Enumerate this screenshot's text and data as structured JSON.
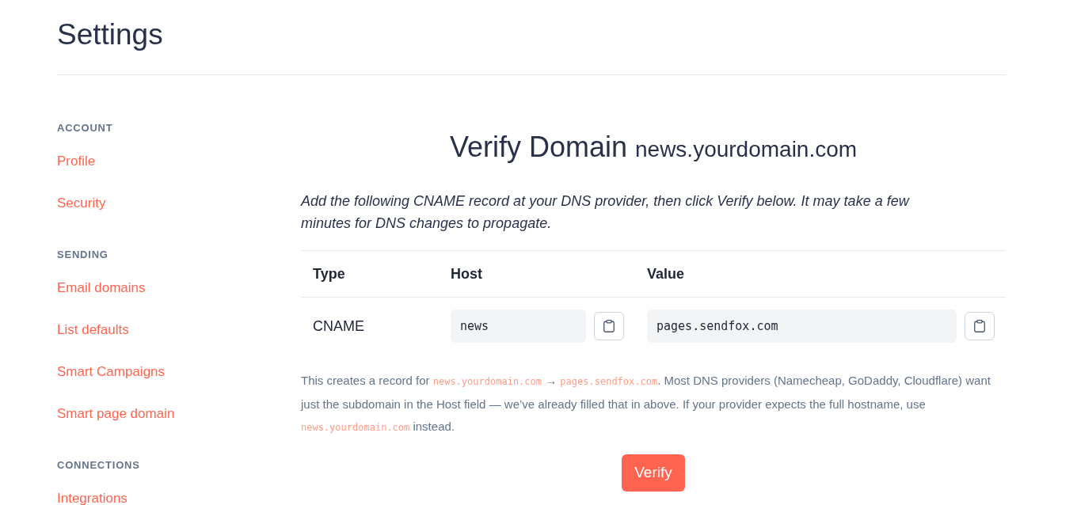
{
  "page": {
    "title": "Settings"
  },
  "sidebar": {
    "sections": [
      {
        "heading": "ACCOUNT",
        "items": [
          "Profile",
          "Security"
        ]
      },
      {
        "heading": "SENDING",
        "items": [
          "Email domains",
          "List defaults",
          "Smart Campaigns",
          "Smart page domain"
        ]
      },
      {
        "heading": "CONNECTIONS",
        "items": [
          "Integrations"
        ]
      }
    ]
  },
  "verify": {
    "title": "Verify Domain",
    "domain": "news.yourdomain.com",
    "instructions": "Add the following CNAME record at your DNS provider, then click Verify below. It may take a few minutes for DNS changes to propagate.",
    "table": {
      "columns": [
        "Type",
        "Host",
        "Value"
      ],
      "rows": [
        {
          "cells": [
            {
              "kind": "text",
              "text": "CNAME"
            },
            {
              "kind": "copy_field",
              "value": "news"
            },
            {
              "kind": "copy_field",
              "value": "pages.sendfox.com"
            }
          ]
        }
      ]
    },
    "note": [
      {
        "kind": "text",
        "text": "This creates a record for "
      },
      {
        "kind": "code",
        "text": "news.yourdomain.com"
      },
      {
        "kind": "text",
        "text": " → "
      },
      {
        "kind": "code",
        "text": "pages.sendfox.com"
      },
      {
        "kind": "text",
        "text": ". Most DNS providers (Namecheap, GoDaddy, Cloudflare) want just the subdomain in the Host field — we’ve already filled that in above. If your provider expects the full hostname, use "
      },
      {
        "kind": "code",
        "text": "news.yourdomain.com"
      },
      {
        "kind": "text",
        "text": " instead."
      }
    ],
    "button": "Verify"
  }
}
